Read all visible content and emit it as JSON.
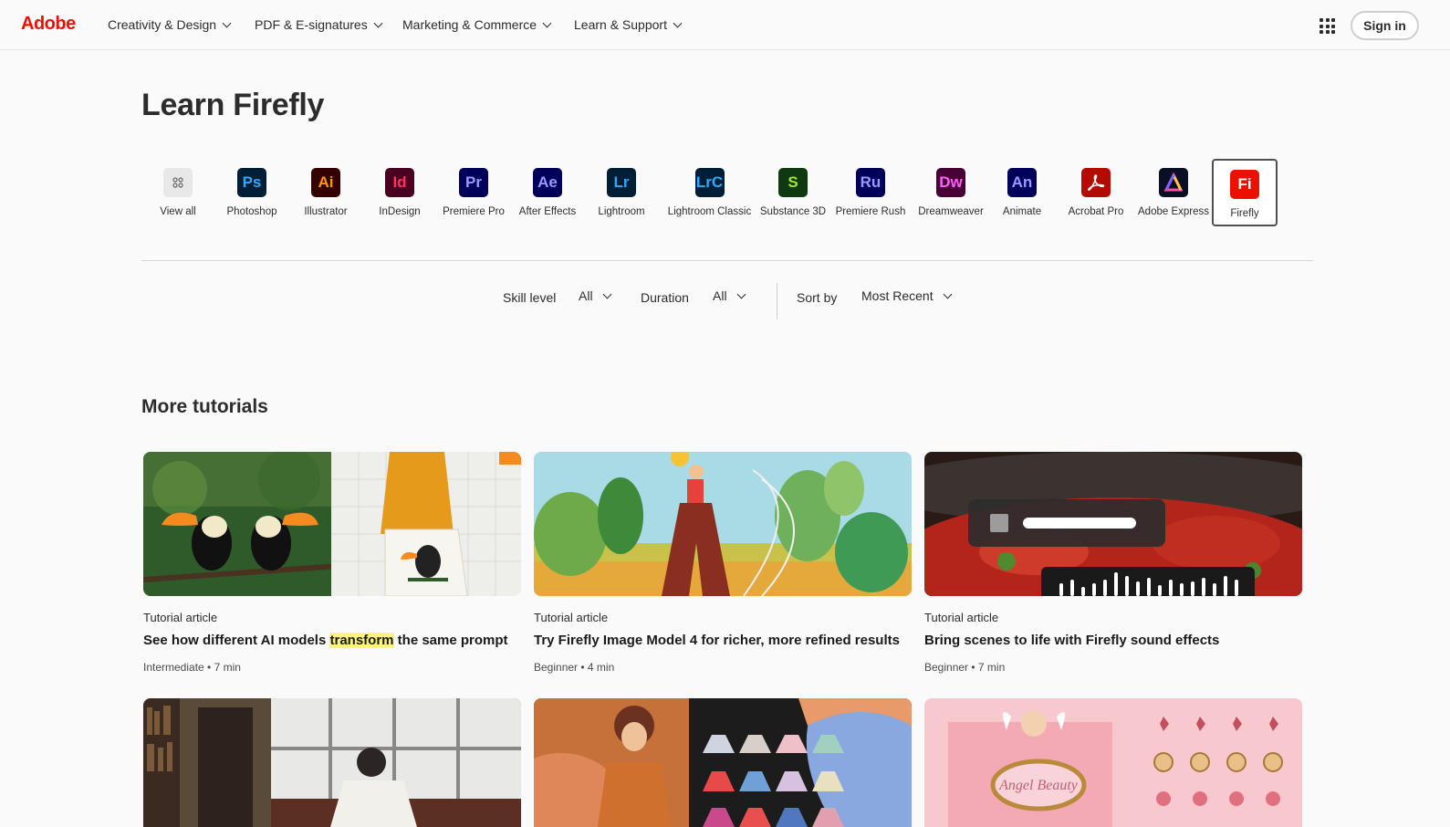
{
  "nav": {
    "logo": "Adobe",
    "items": [
      {
        "label": "Creativity & Design"
      },
      {
        "label": "PDF & E-signatures"
      },
      {
        "label": "Marketing & Commerce"
      },
      {
        "label": "Learn & Support"
      }
    ],
    "apps_icon": "grid-icon",
    "signin": "Sign in"
  },
  "page": {
    "title": "Learn Firefly"
  },
  "products": [
    {
      "label": "View all",
      "abbr": "",
      "bg": "#e8e8e8",
      "fg": "#666666",
      "icon": "grid-icon"
    },
    {
      "label": "Photoshop",
      "abbr": "Ps",
      "bg": "#001e36",
      "fg": "#31a8ff"
    },
    {
      "label": "Illustrator",
      "abbr": "Ai",
      "bg": "#330000",
      "fg": "#ff9a00"
    },
    {
      "label": "InDesign",
      "abbr": "Id",
      "bg": "#49021f",
      "fg": "#ff3366"
    },
    {
      "label": "Premiere Pro",
      "abbr": "Pr",
      "bg": "#00005b",
      "fg": "#9999ff"
    },
    {
      "label": "After Effects",
      "abbr": "Ae",
      "bg": "#00005b",
      "fg": "#9999ff"
    },
    {
      "label": "Lightroom",
      "abbr": "Lr",
      "bg": "#001e36",
      "fg": "#31a8ff"
    },
    {
      "label": "Lightroom Classic",
      "abbr": "LrC",
      "bg": "#001e36",
      "fg": "#31a8ff"
    },
    {
      "label": "Substance 3D",
      "abbr": "S",
      "bg": "#0f3a0f",
      "fg": "#a3e635"
    },
    {
      "label": "Premiere Rush",
      "abbr": "Ru",
      "bg": "#00005b",
      "fg": "#9999ff"
    },
    {
      "label": "Dreamweaver",
      "abbr": "Dw",
      "bg": "#470137",
      "fg": "#ff61f6"
    },
    {
      "label": "Animate",
      "abbr": "An",
      "bg": "#00005b",
      "fg": "#9999ff"
    },
    {
      "label": "Acrobat Pro",
      "abbr": "",
      "bg": "#b30b00",
      "fg": "#ffffff",
      "icon": "acrobat-icon"
    },
    {
      "label": "Adobe Express",
      "abbr": "",
      "bg": "#0a0f25",
      "fg": "#ffffff",
      "icon": "express-icon"
    },
    {
      "label": "Firefly",
      "abbr": "Fi",
      "bg": "#eb1000",
      "fg": "#ffffff",
      "selected": true
    }
  ],
  "filters": {
    "skill_label": "Skill level",
    "skill_value": "All",
    "duration_label": "Duration",
    "duration_value": "All",
    "sort_label": "Sort by",
    "sort_value": "Most Recent"
  },
  "section": {
    "title": "More tutorials"
  },
  "cards": [
    {
      "type": "Tutorial article",
      "title_pre": "See how different AI models ",
      "title_hl": "transform",
      "title_post": " the same prompt",
      "meta": "Intermediate • 7 min"
    },
    {
      "type": "Tutorial article",
      "title_pre": "Try Firefly Image Model 4 for richer, more refined results",
      "title_hl": "",
      "title_post": "",
      "meta": "Beginner • 4 min"
    },
    {
      "type": "Tutorial article",
      "title_pre": "Bring scenes to life with Firefly sound effects",
      "title_hl": "",
      "title_post": "",
      "meta": "Beginner • 7 min"
    },
    {
      "type": "",
      "title_pre": "",
      "title_hl": "",
      "title_post": "",
      "meta": ""
    },
    {
      "type": "",
      "title_pre": "",
      "title_hl": "",
      "title_post": "",
      "meta": ""
    },
    {
      "type": "",
      "title_pre": "",
      "title_hl": "",
      "title_post": "",
      "meta": "",
      "thumb_text": "Angel Beauty"
    }
  ]
}
